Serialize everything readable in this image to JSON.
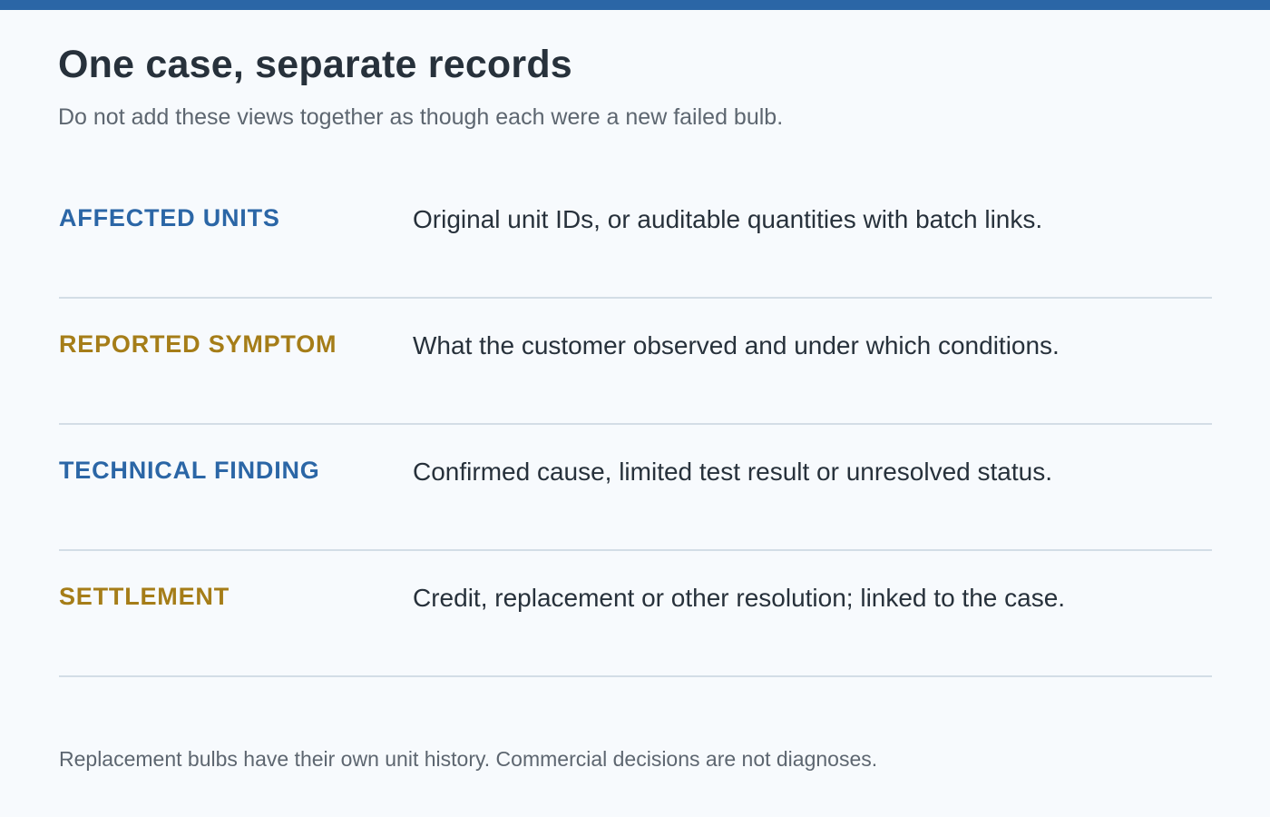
{
  "header": {
    "title": "One case, separate records",
    "subtitle": "Do not add these views together as though each were a new failed bulb."
  },
  "records": [
    {
      "label": "AFFECTED UNITS",
      "description": "Original unit IDs, or auditable quantities with batch links.",
      "accent": "#2b66a6"
    },
    {
      "label": "REPORTED SYMPTOM",
      "description": "What the customer observed and under which conditions.",
      "accent": "#a57d18"
    },
    {
      "label": "TECHNICAL FINDING",
      "description": "Confirmed cause, limited test result or unresolved status.",
      "accent": "#2b66a6"
    },
    {
      "label": "SETTLEMENT",
      "description": "Credit, replacement or other resolution; linked to the case.",
      "accent": "#a57d18"
    }
  ],
  "footnote": "Replacement bulbs have their own unit history. Commercial decisions are not diagnoses.",
  "colors": {
    "top_bar": "#2b66a6",
    "background": "#f7fafd",
    "divider": "#d3dde6"
  }
}
